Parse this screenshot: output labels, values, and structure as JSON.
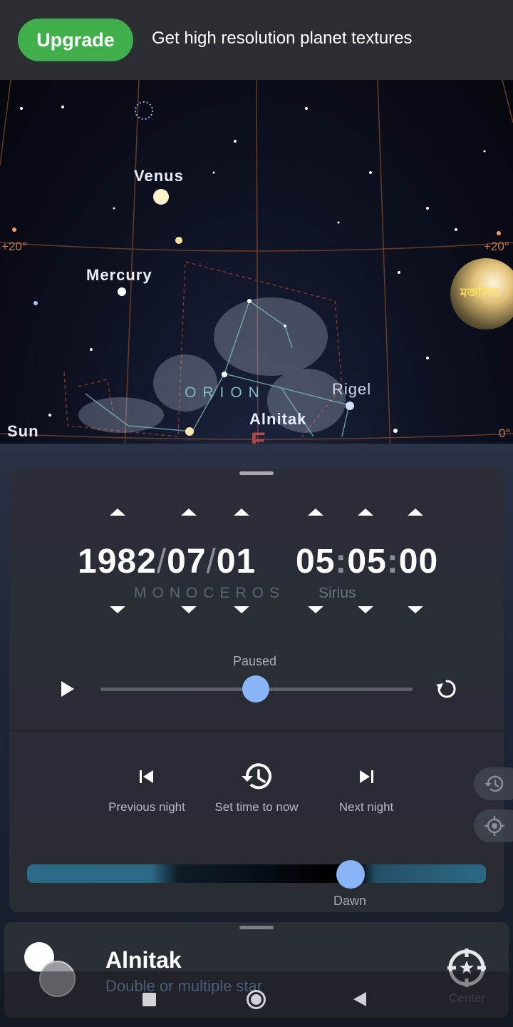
{
  "banner": {
    "upgrade_label": "Upgrade",
    "message": "Get high resolution planet textures",
    "accent": "#3fae4b"
  },
  "sky": {
    "labels": {
      "venus": "Venus",
      "mercury": "Mercury",
      "sun": "Sun",
      "rigel": "Rigel",
      "alnitak": "Alnitak",
      "constellation": "ORION",
      "direction": "E"
    },
    "degrees": {
      "left_20": "+20°",
      "right_20": "+20°",
      "right_0": "0°"
    },
    "moon_badge_text": "মজলিস"
  },
  "time_panel": {
    "date": {
      "year": "1982",
      "sep1": "/",
      "month": "07",
      "sep2": "/",
      "day": "01"
    },
    "time": {
      "hour": "05",
      "sep1": ":",
      "minute": "05",
      "sep2": ":",
      "second": "00"
    },
    "background_constellation": "MONOCEROS",
    "background_star": "Sirius",
    "status": "Paused",
    "speed_level": 0.5,
    "navigation": {
      "previous": "Previous night",
      "now": "Set time to now",
      "next": "Next night"
    },
    "twilight": {
      "label": "Dawn",
      "position": 0.7
    }
  },
  "info_card": {
    "title": "Alnitak",
    "subtitle": "Double or multiple star",
    "center_label": "Center"
  },
  "icons": [
    "play-icon",
    "reset-icon",
    "skip-previous-icon",
    "history-icon",
    "skip-next-icon",
    "target-icon",
    "crosshair-star-icon",
    "square-icon",
    "home-icon",
    "back-icon"
  ]
}
